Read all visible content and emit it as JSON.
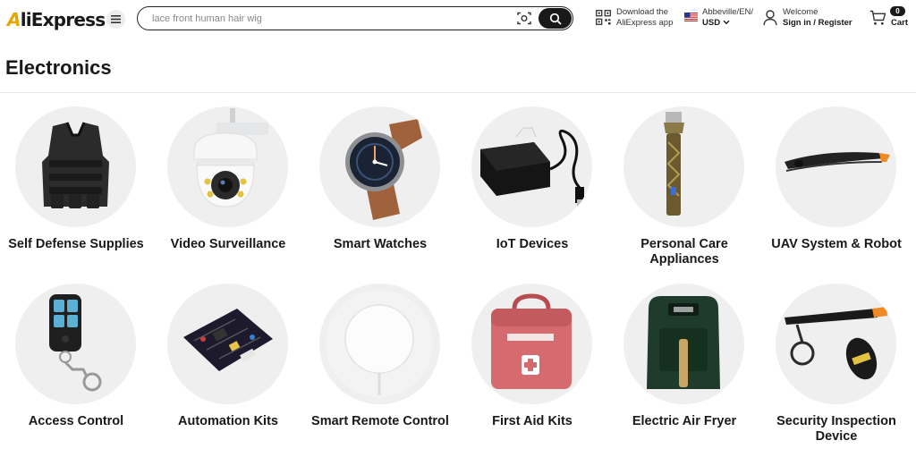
{
  "header": {
    "logo_text": "AliExpress",
    "search": {
      "placeholder": "lace front human hair wig"
    },
    "download": {
      "line1": "Download the",
      "line2": "AliExpress app"
    },
    "region": {
      "line1": "Abbeville/EN/",
      "line2": "USD"
    },
    "account": {
      "line1": "Welcome",
      "line2": "Sign in / Register"
    },
    "cart": {
      "count": "0",
      "label": "Cart"
    }
  },
  "page": {
    "title": "Electronics"
  },
  "categories": [
    {
      "label": "Self Defense Supplies",
      "icon": "tactical-vest"
    },
    {
      "label": "Video Surveillance",
      "icon": "security-camera"
    },
    {
      "label": "Smart Watches",
      "icon": "smart-watch"
    },
    {
      "label": "IoT Devices",
      "icon": "card-reader"
    },
    {
      "label": "Personal Care Appliances",
      "icon": "hair-trimmer"
    },
    {
      "label": "UAV System & Robot",
      "icon": "propeller"
    },
    {
      "label": "Access Control",
      "icon": "remote-key"
    },
    {
      "label": "Automation Kits",
      "icon": "circuit-board"
    },
    {
      "label": "Smart Remote Control",
      "icon": "smart-hub"
    },
    {
      "label": "First Aid Kits",
      "icon": "first-aid-bag"
    },
    {
      "label": "Electric Air Fryer",
      "icon": "air-fryer"
    },
    {
      "label": "Security Inspection Device",
      "icon": "metal-detector"
    }
  ],
  "colors": {
    "accent": "#e8a400",
    "dark": "#191919",
    "circle": "#efefef"
  }
}
